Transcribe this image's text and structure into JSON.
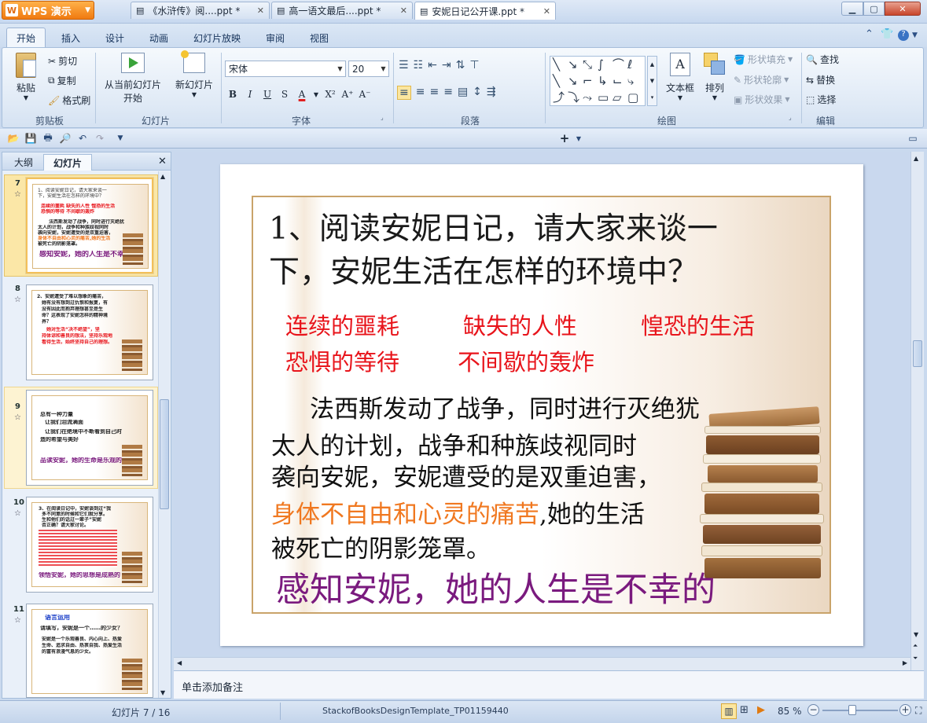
{
  "app": {
    "name": "WPS 演示",
    "window_title": "安妮日记公开课.ppt *"
  },
  "menu_tabs": [
    "开始",
    "插入",
    "设计",
    "动画",
    "幻灯片放映",
    "审阅",
    "视图"
  ],
  "ribbon": {
    "clipboard": {
      "paste": "粘贴",
      "cut": "剪切",
      "copy": "复制",
      "format_painter": "格式刷",
      "group": "剪贴板"
    },
    "slides": {
      "from_current_line1": "从当前幻灯片",
      "from_current_line2": "开始",
      "new_slide": "新幻灯片",
      "group": "幻灯片"
    },
    "font": {
      "font_name": "宋体",
      "font_size": "20",
      "group": "字体"
    },
    "paragraph": {
      "group": "段落"
    },
    "drawing": {
      "textbox": "文本框",
      "arrange": "排列",
      "shape_fill": "形状填充",
      "shape_outline": "形状轮廓",
      "shape_effects": "形状效果",
      "group": "绘图"
    },
    "editing": {
      "find": "查找",
      "replace": "替换",
      "select": "选择",
      "group": "编辑"
    }
  },
  "doc_tabs": [
    {
      "label": "《水浒传》阅....ppt *"
    },
    {
      "label": "高一语文最后....ppt *"
    },
    {
      "label": "安妮日记公开课.ppt *"
    }
  ],
  "left_pane": {
    "tabs": [
      "大纲",
      "幻灯片"
    ],
    "thumbnails": [
      {
        "number": "7",
        "lines": [
          "1、阅读安妮日记，请大家来谈一",
          "下，安妮生活在怎样的环境中？",
          "连续的噩耗  缺失的人性  惶恐的生活",
          "恐惧的等待  不间歇的轰炸",
          "法西斯发动了战争，同时进行灭绝犹",
          "太人的计划，战争和种族歧视同时",
          "袭向安妮，安妮遭受的是双重迫害，",
          "身体不自由和心灵的痛苦,她的生活",
          "被死亡的阴影笼罩。",
          "感知安妮，她的人生是不幸的"
        ]
      },
      {
        "number": "8",
        "lines": [
          "2、安妮遭受了难以想象的痛苦，",
          "她有没有想到过仇恨和报复，有",
          "没有因此而抱弃理想甚至是生",
          "命？这表现了安妮怎样的精神境",
          "界？",
          "她对生活“决不绝望”，坚",
          "持体谅和善良的想法，坚持乐观地",
          "看待生活，始终坚持自己的理想。"
        ]
      },
      {
        "number": "9",
        "lines": [
          "总有一种力量",
          "让我们泪流满面",
          "让我们在绝境中不断看到自己时",
          "造的希望与美好",
          "品读安妮，她的生命是乐观的"
        ]
      },
      {
        "number": "10",
        "lines": [
          "3、在阅读日记中，安妮谈到过“我",
          "多不同意的时候和它们就分享。",
          "生和他们的话过一辈子”安妮",
          "否正确？请大家讨论。",
          "领悟安妮，她的思想是成熟的"
        ]
      },
      {
        "number": "11",
        "lines": [
          "语言运用",
          "请填写，安妮是一个……的少女？",
          "安妮是一个乐观善良、内心向上、热爱",
          "生命、追求自由、热衷自我、热爱生活",
          "的富有浪漫气息的少女。"
        ]
      }
    ]
  },
  "slide": {
    "question_line1": "1、阅读安妮日记，请大家来谈一",
    "question_line2": "下，安妮生活在怎样的环境中？",
    "keywords_row1": [
      "连续的噩耗",
      "缺失的人性",
      "惶恐的生活"
    ],
    "keywords_row2": [
      "恐惧的等待",
      "不间歇的轰炸"
    ],
    "body_line1": "法西斯发动了战争，同时进行灭绝犹",
    "body_line2": "太人的计划，战争和种族歧视同时",
    "body_line3": "袭向安妮，安妮遭受的是双重迫害，",
    "body_line4_highlight": "身体不自由和心灵的痛苦",
    "body_line4_rest": ",她的生活",
    "body_line5": "被死亡的阴影笼罩。",
    "conclusion": "感知安妮，她的人生是不幸的"
  },
  "notes_placeholder": "单击添加备注",
  "status": {
    "slide_counter": "幻灯片 7 / 16",
    "template": "StackofBooksDesignTemplate_TP01159440",
    "zoom": "85 %"
  },
  "colors": {
    "keyword_red": "#e8141b",
    "highlight_orange": "#f07820",
    "conclusion_purple": "#7a1a7e",
    "accent_orange": "#f07a10"
  }
}
